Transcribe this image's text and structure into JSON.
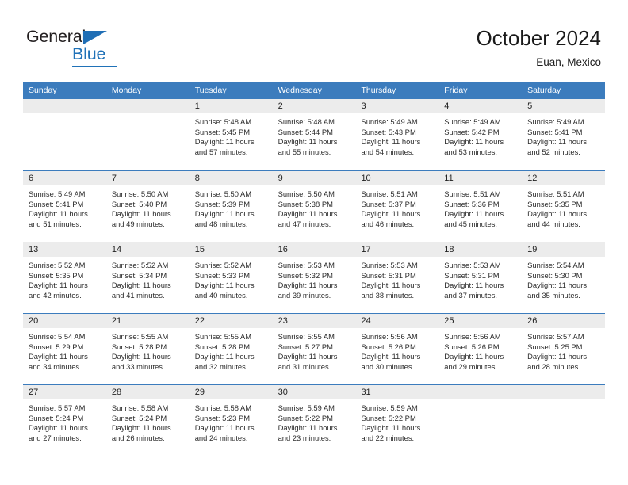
{
  "brand": {
    "name_top": "General",
    "name_bottom": "Blue",
    "triangle_color": "#1f6eb5",
    "accent_color": "#2072b8"
  },
  "header": {
    "title": "October 2024",
    "subtitle": "Euan, Mexico"
  },
  "colors": {
    "header_blue": "#3c7cbd",
    "date_band_gray": "#ececec",
    "text": "#2b2b2b"
  },
  "calendar": {
    "weekday_headers": [
      "Sunday",
      "Monday",
      "Tuesday",
      "Wednesday",
      "Thursday",
      "Friday",
      "Saturday"
    ],
    "labels": {
      "sunrise_prefix": "Sunrise:",
      "sunset_prefix": "Sunset:",
      "daylight_prefix": "Daylight:"
    },
    "weeks": [
      [
        {
          "date": "",
          "sunrise": "",
          "sunset": "",
          "daylight_1": "",
          "daylight_2": ""
        },
        {
          "date": "",
          "sunrise": "",
          "sunset": "",
          "daylight_1": "",
          "daylight_2": ""
        },
        {
          "date": "1",
          "sunrise": "Sunrise: 5:48 AM",
          "sunset": "Sunset: 5:45 PM",
          "daylight_1": "Daylight: 11 hours",
          "daylight_2": "and 57 minutes."
        },
        {
          "date": "2",
          "sunrise": "Sunrise: 5:48 AM",
          "sunset": "Sunset: 5:44 PM",
          "daylight_1": "Daylight: 11 hours",
          "daylight_2": "and 55 minutes."
        },
        {
          "date": "3",
          "sunrise": "Sunrise: 5:49 AM",
          "sunset": "Sunset: 5:43 PM",
          "daylight_1": "Daylight: 11 hours",
          "daylight_2": "and 54 minutes."
        },
        {
          "date": "4",
          "sunrise": "Sunrise: 5:49 AM",
          "sunset": "Sunset: 5:42 PM",
          "daylight_1": "Daylight: 11 hours",
          "daylight_2": "and 53 minutes."
        },
        {
          "date": "5",
          "sunrise": "Sunrise: 5:49 AM",
          "sunset": "Sunset: 5:41 PM",
          "daylight_1": "Daylight: 11 hours",
          "daylight_2": "and 52 minutes."
        }
      ],
      [
        {
          "date": "6",
          "sunrise": "Sunrise: 5:49 AM",
          "sunset": "Sunset: 5:41 PM",
          "daylight_1": "Daylight: 11 hours",
          "daylight_2": "and 51 minutes."
        },
        {
          "date": "7",
          "sunrise": "Sunrise: 5:50 AM",
          "sunset": "Sunset: 5:40 PM",
          "daylight_1": "Daylight: 11 hours",
          "daylight_2": "and 49 minutes."
        },
        {
          "date": "8",
          "sunrise": "Sunrise: 5:50 AM",
          "sunset": "Sunset: 5:39 PM",
          "daylight_1": "Daylight: 11 hours",
          "daylight_2": "and 48 minutes."
        },
        {
          "date": "9",
          "sunrise": "Sunrise: 5:50 AM",
          "sunset": "Sunset: 5:38 PM",
          "daylight_1": "Daylight: 11 hours",
          "daylight_2": "and 47 minutes."
        },
        {
          "date": "10",
          "sunrise": "Sunrise: 5:51 AM",
          "sunset": "Sunset: 5:37 PM",
          "daylight_1": "Daylight: 11 hours",
          "daylight_2": "and 46 minutes."
        },
        {
          "date": "11",
          "sunrise": "Sunrise: 5:51 AM",
          "sunset": "Sunset: 5:36 PM",
          "daylight_1": "Daylight: 11 hours",
          "daylight_2": "and 45 minutes."
        },
        {
          "date": "12",
          "sunrise": "Sunrise: 5:51 AM",
          "sunset": "Sunset: 5:35 PM",
          "daylight_1": "Daylight: 11 hours",
          "daylight_2": "and 44 minutes."
        }
      ],
      [
        {
          "date": "13",
          "sunrise": "Sunrise: 5:52 AM",
          "sunset": "Sunset: 5:35 PM",
          "daylight_1": "Daylight: 11 hours",
          "daylight_2": "and 42 minutes."
        },
        {
          "date": "14",
          "sunrise": "Sunrise: 5:52 AM",
          "sunset": "Sunset: 5:34 PM",
          "daylight_1": "Daylight: 11 hours",
          "daylight_2": "and 41 minutes."
        },
        {
          "date": "15",
          "sunrise": "Sunrise: 5:52 AM",
          "sunset": "Sunset: 5:33 PM",
          "daylight_1": "Daylight: 11 hours",
          "daylight_2": "and 40 minutes."
        },
        {
          "date": "16",
          "sunrise": "Sunrise: 5:53 AM",
          "sunset": "Sunset: 5:32 PM",
          "daylight_1": "Daylight: 11 hours",
          "daylight_2": "and 39 minutes."
        },
        {
          "date": "17",
          "sunrise": "Sunrise: 5:53 AM",
          "sunset": "Sunset: 5:31 PM",
          "daylight_1": "Daylight: 11 hours",
          "daylight_2": "and 38 minutes."
        },
        {
          "date": "18",
          "sunrise": "Sunrise: 5:53 AM",
          "sunset": "Sunset: 5:31 PM",
          "daylight_1": "Daylight: 11 hours",
          "daylight_2": "and 37 minutes."
        },
        {
          "date": "19",
          "sunrise": "Sunrise: 5:54 AM",
          "sunset": "Sunset: 5:30 PM",
          "daylight_1": "Daylight: 11 hours",
          "daylight_2": "and 35 minutes."
        }
      ],
      [
        {
          "date": "20",
          "sunrise": "Sunrise: 5:54 AM",
          "sunset": "Sunset: 5:29 PM",
          "daylight_1": "Daylight: 11 hours",
          "daylight_2": "and 34 minutes."
        },
        {
          "date": "21",
          "sunrise": "Sunrise: 5:55 AM",
          "sunset": "Sunset: 5:28 PM",
          "daylight_1": "Daylight: 11 hours",
          "daylight_2": "and 33 minutes."
        },
        {
          "date": "22",
          "sunrise": "Sunrise: 5:55 AM",
          "sunset": "Sunset: 5:28 PM",
          "daylight_1": "Daylight: 11 hours",
          "daylight_2": "and 32 minutes."
        },
        {
          "date": "23",
          "sunrise": "Sunrise: 5:55 AM",
          "sunset": "Sunset: 5:27 PM",
          "daylight_1": "Daylight: 11 hours",
          "daylight_2": "and 31 minutes."
        },
        {
          "date": "24",
          "sunrise": "Sunrise: 5:56 AM",
          "sunset": "Sunset: 5:26 PM",
          "daylight_1": "Daylight: 11 hours",
          "daylight_2": "and 30 minutes."
        },
        {
          "date": "25",
          "sunrise": "Sunrise: 5:56 AM",
          "sunset": "Sunset: 5:26 PM",
          "daylight_1": "Daylight: 11 hours",
          "daylight_2": "and 29 minutes."
        },
        {
          "date": "26",
          "sunrise": "Sunrise: 5:57 AM",
          "sunset": "Sunset: 5:25 PM",
          "daylight_1": "Daylight: 11 hours",
          "daylight_2": "and 28 minutes."
        }
      ],
      [
        {
          "date": "27",
          "sunrise": "Sunrise: 5:57 AM",
          "sunset": "Sunset: 5:24 PM",
          "daylight_1": "Daylight: 11 hours",
          "daylight_2": "and 27 minutes."
        },
        {
          "date": "28",
          "sunrise": "Sunrise: 5:58 AM",
          "sunset": "Sunset: 5:24 PM",
          "daylight_1": "Daylight: 11 hours",
          "daylight_2": "and 26 minutes."
        },
        {
          "date": "29",
          "sunrise": "Sunrise: 5:58 AM",
          "sunset": "Sunset: 5:23 PM",
          "daylight_1": "Daylight: 11 hours",
          "daylight_2": "and 24 minutes."
        },
        {
          "date": "30",
          "sunrise": "Sunrise: 5:59 AM",
          "sunset": "Sunset: 5:22 PM",
          "daylight_1": "Daylight: 11 hours",
          "daylight_2": "and 23 minutes."
        },
        {
          "date": "31",
          "sunrise": "Sunrise: 5:59 AM",
          "sunset": "Sunset: 5:22 PM",
          "daylight_1": "Daylight: 11 hours",
          "daylight_2": "and 22 minutes."
        },
        {
          "date": "",
          "sunrise": "",
          "sunset": "",
          "daylight_1": "",
          "daylight_2": ""
        },
        {
          "date": "",
          "sunrise": "",
          "sunset": "",
          "daylight_1": "",
          "daylight_2": ""
        }
      ]
    ]
  }
}
